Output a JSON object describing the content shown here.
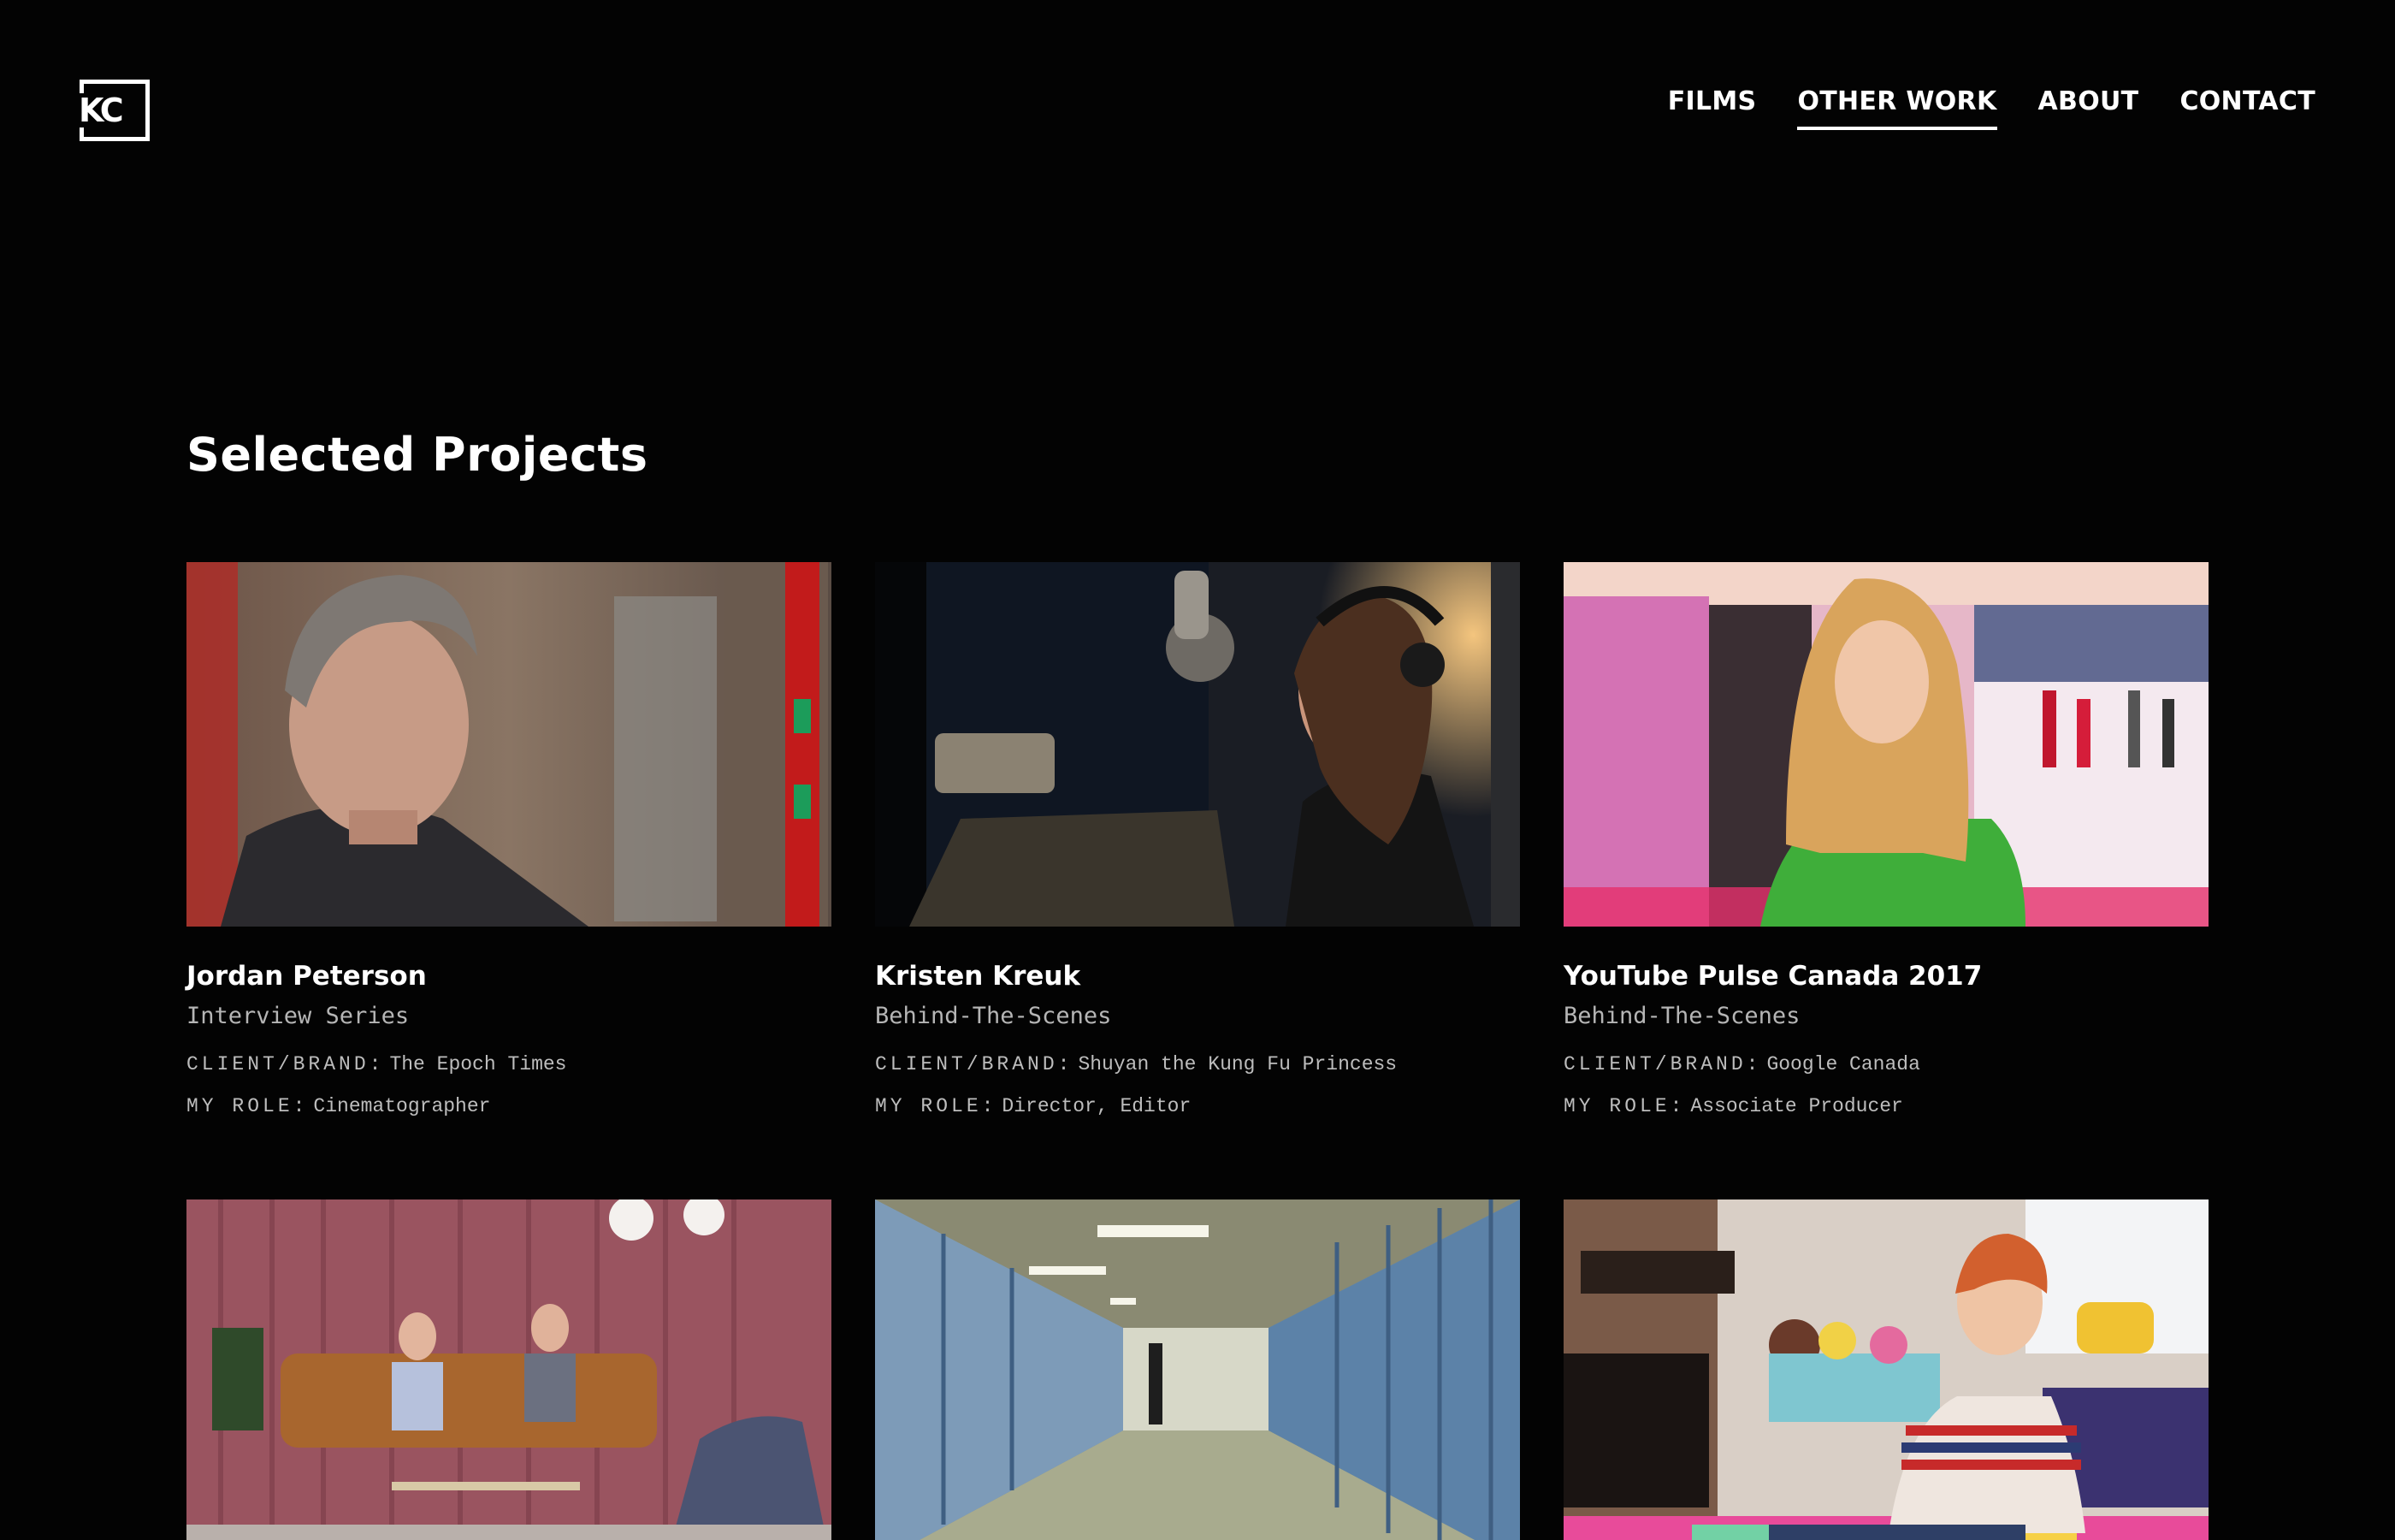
{
  "logo": {
    "text": "KC"
  },
  "nav": {
    "items": [
      {
        "label": "FILMS"
      },
      {
        "label": "OTHER WORK"
      },
      {
        "label": "ABOUT"
      },
      {
        "label": "CONTACT"
      }
    ]
  },
  "section": {
    "title": "Selected Projects"
  },
  "labels": {
    "client": "CLIENT/BRAND:",
    "role": "MY ROLE:"
  },
  "projects": [
    {
      "title": "Jordan Peterson",
      "subtitle": "Interview Series",
      "client": "The Epoch Times",
      "role": "Cinematographer"
    },
    {
      "title": "Kristen Kreuk",
      "subtitle": "Behind-The-Scenes",
      "client": "Shuyan the Kung Fu Princess",
      "role": "Director, Editor"
    },
    {
      "title": "YouTube Pulse Canada 2017",
      "subtitle": "Behind-The-Scenes",
      "client": "Google Canada",
      "role": "Associate Producer"
    },
    {
      "title": "",
      "subtitle": "",
      "client": "",
      "role": ""
    },
    {
      "title": "",
      "subtitle": "",
      "client": "",
      "role": ""
    },
    {
      "title": "",
      "subtitle": "",
      "client": "",
      "role": ""
    }
  ]
}
